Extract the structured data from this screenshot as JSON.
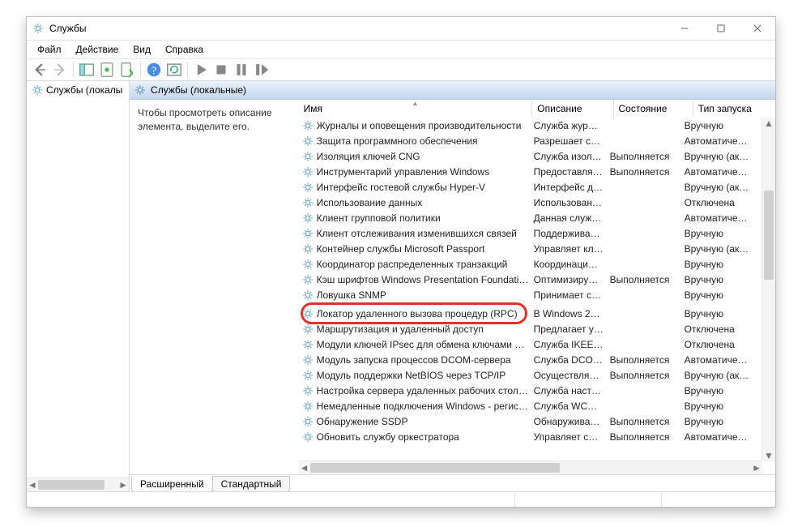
{
  "window": {
    "title": "Службы"
  },
  "menu": {
    "file": "Файл",
    "action": "Действие",
    "view": "Вид",
    "help": "Справка"
  },
  "tree": {
    "root": "Службы (локалы"
  },
  "pane": {
    "title": "Службы (локальные)",
    "help_text": "Чтобы просмотреть описание элемента, выделите его."
  },
  "columns": {
    "name": "Имя",
    "description": "Описание",
    "state": "Состояние",
    "startup": "Тип запуска"
  },
  "state_labels": {
    "running": "Выполняется"
  },
  "tabs": {
    "extended": "Расширенный",
    "standard": "Стандартный"
  },
  "highlight_index": 13,
  "services": [
    {
      "name": "Журналы и оповещения производительности",
      "desc": "Служба жур…",
      "state": "",
      "startup": "Вручную"
    },
    {
      "name": "Защита программного обеспечения",
      "desc": "Разрешает с…",
      "state": "",
      "startup": "Автоматиче…"
    },
    {
      "name": "Изоляция ключей CNG",
      "desc": "Служба изол…",
      "state": "running",
      "startup": "Вручную (ак…"
    },
    {
      "name": "Инструментарий управления Windows",
      "desc": "Предоставля…",
      "state": "running",
      "startup": "Автоматиче…"
    },
    {
      "name": "Интерфейс гостевой службы Hyper-V",
      "desc": "Интерфейс д…",
      "state": "",
      "startup": "Вручную (ак…"
    },
    {
      "name": "Использование данных",
      "desc": "Использован…",
      "state": "",
      "startup": "Отключена"
    },
    {
      "name": "Клиент групповой политики",
      "desc": "Данная служ…",
      "state": "",
      "startup": "Автоматиче…"
    },
    {
      "name": "Клиент отслеживания изменившихся связей",
      "desc": "Поддержива…",
      "state": "",
      "startup": "Вручную"
    },
    {
      "name": "Контейнер службы Microsoft Passport",
      "desc": "Управляет кл…",
      "state": "",
      "startup": "Вручную (ак…"
    },
    {
      "name": "Координатор распределенных транзакций",
      "desc": "Координаци…",
      "state": "",
      "startup": "Вручную"
    },
    {
      "name": "Кэш шрифтов Windows Presentation Foundation…",
      "desc": "Оптимизиру…",
      "state": "running",
      "startup": "Вручную"
    },
    {
      "name": "Ловушка SNMP",
      "desc": "Принимает с…",
      "state": "",
      "startup": "Вручную"
    },
    {
      "name": "",
      "desc": "",
      "state": "",
      "startup": ""
    },
    {
      "name": "Локатор удаленного вызова процедур (RPC)",
      "desc": "В Windows 2…",
      "state": "",
      "startup": "Вручную"
    },
    {
      "name": "Маршрутизация и удаленный доступ",
      "desc": "Предлагает у…",
      "state": "",
      "startup": "Отключена"
    },
    {
      "name": "Модули ключей IPsec для обмена ключами в …",
      "desc": "Служба IKEE…",
      "state": "",
      "startup": "Отключена"
    },
    {
      "name": "Модуль запуска процессов DCOM-сервера",
      "desc": "Служба DCO…",
      "state": "running",
      "startup": "Автоматиче…"
    },
    {
      "name": "Модуль поддержки NetBIOS через TCP/IP",
      "desc": "Осуществля…",
      "state": "running",
      "startup": "Вручную (ак…"
    },
    {
      "name": "Настройка сервера удаленных рабочих столов",
      "desc": "Служба наст…",
      "state": "",
      "startup": "Вручную"
    },
    {
      "name": "Немедленные подключения Windows - регист…",
      "desc": "Служба WC…",
      "state": "",
      "startup": "Вручную"
    },
    {
      "name": "Обнаружение SSDP",
      "desc": "Обнаружива…",
      "state": "running",
      "startup": "Вручную"
    },
    {
      "name": "Обновить службу оркестратора",
      "desc": "Управляет с…",
      "state": "running",
      "startup": "Автоматиче…"
    }
  ],
  "col_widths": {
    "name": 284,
    "desc": 94,
    "state": 92,
    "startup": 96
  }
}
